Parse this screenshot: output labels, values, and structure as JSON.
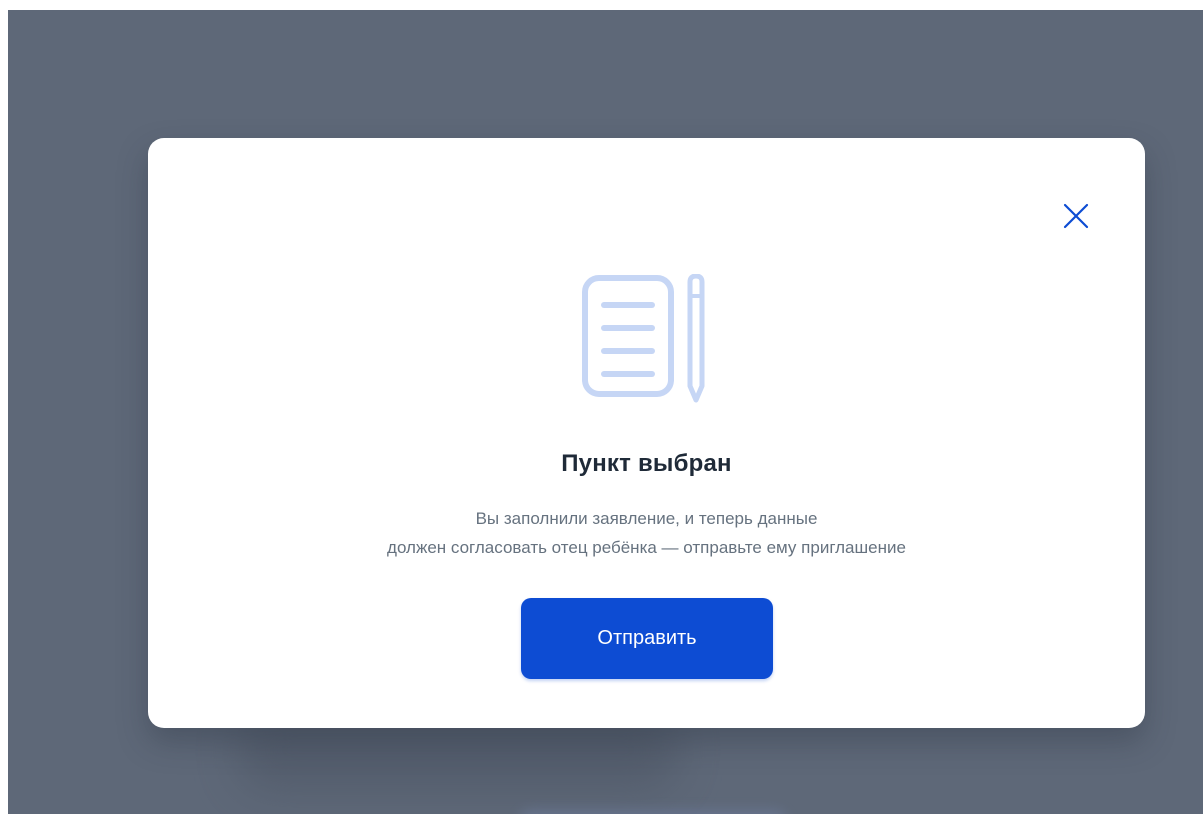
{
  "modal": {
    "title": "Пункт выбран",
    "description_lines": [
      "Вы заполнили заявление, и теперь данные",
      "должен согласовать отец ребёнка — отправьте ему приглашение"
    ],
    "primary_button_label": "Отправить",
    "close_icon": "close-icon",
    "illustration_icon": "document-with-pencil-icon"
  },
  "colors": {
    "overlay": "#5e6878",
    "primary": "#0d4cd3",
    "icon_light": "#c6d6f5",
    "close_icon": "#0d4cd3",
    "title": "#1f2a38",
    "text_secondary": "#66727f"
  }
}
